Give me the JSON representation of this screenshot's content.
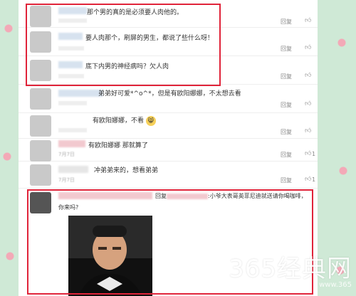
{
  "comments": [
    {
      "name": "",
      "text": "那个男的真的是必须要人肉他的。",
      "time": "",
      "reply": "回复",
      "like_icon": "thumbs-up"
    },
    {
      "name": "",
      "text": "要人肉那个，刷屏的男生，都说了些什么呀！",
      "time": "",
      "reply": "回复",
      "like_icon": "thumbs-up"
    },
    {
      "name": "",
      "text": "底下内男的神经病吗？欠人肉",
      "time": "",
      "reply": "回复",
      "like_icon": "thumbs-up"
    },
    {
      "name": "",
      "text": "弟弟好可爱*^o^*，但是有欧阳娜娜，不太想去看",
      "time": "",
      "reply": "回复",
      "like_icon": "thumbs-up"
    },
    {
      "name": "",
      "text": "有欧阳娜娜，不看",
      "time": "",
      "reply": "回复",
      "like_icon": "thumbs-up"
    },
    {
      "name": "",
      "text": "有欧阳娜娜 那就算了",
      "time": "7月7日",
      "reply": "回复",
      "like_count": "1"
    },
    {
      "name": "",
      "text": "冲弟弟来的，想看弟弟",
      "time": "7月7日",
      "reply": "回复",
      "like_count": "1"
    }
  ],
  "last_comment": {
    "text1": "回复",
    "text2": ":小爷大表哥英菲尼迪就送请你喝咖啡，",
    "text3": "你来吗?"
  },
  "emoji_glyph": "😸",
  "watermark": "365经典网",
  "watermark_url": "www.365"
}
